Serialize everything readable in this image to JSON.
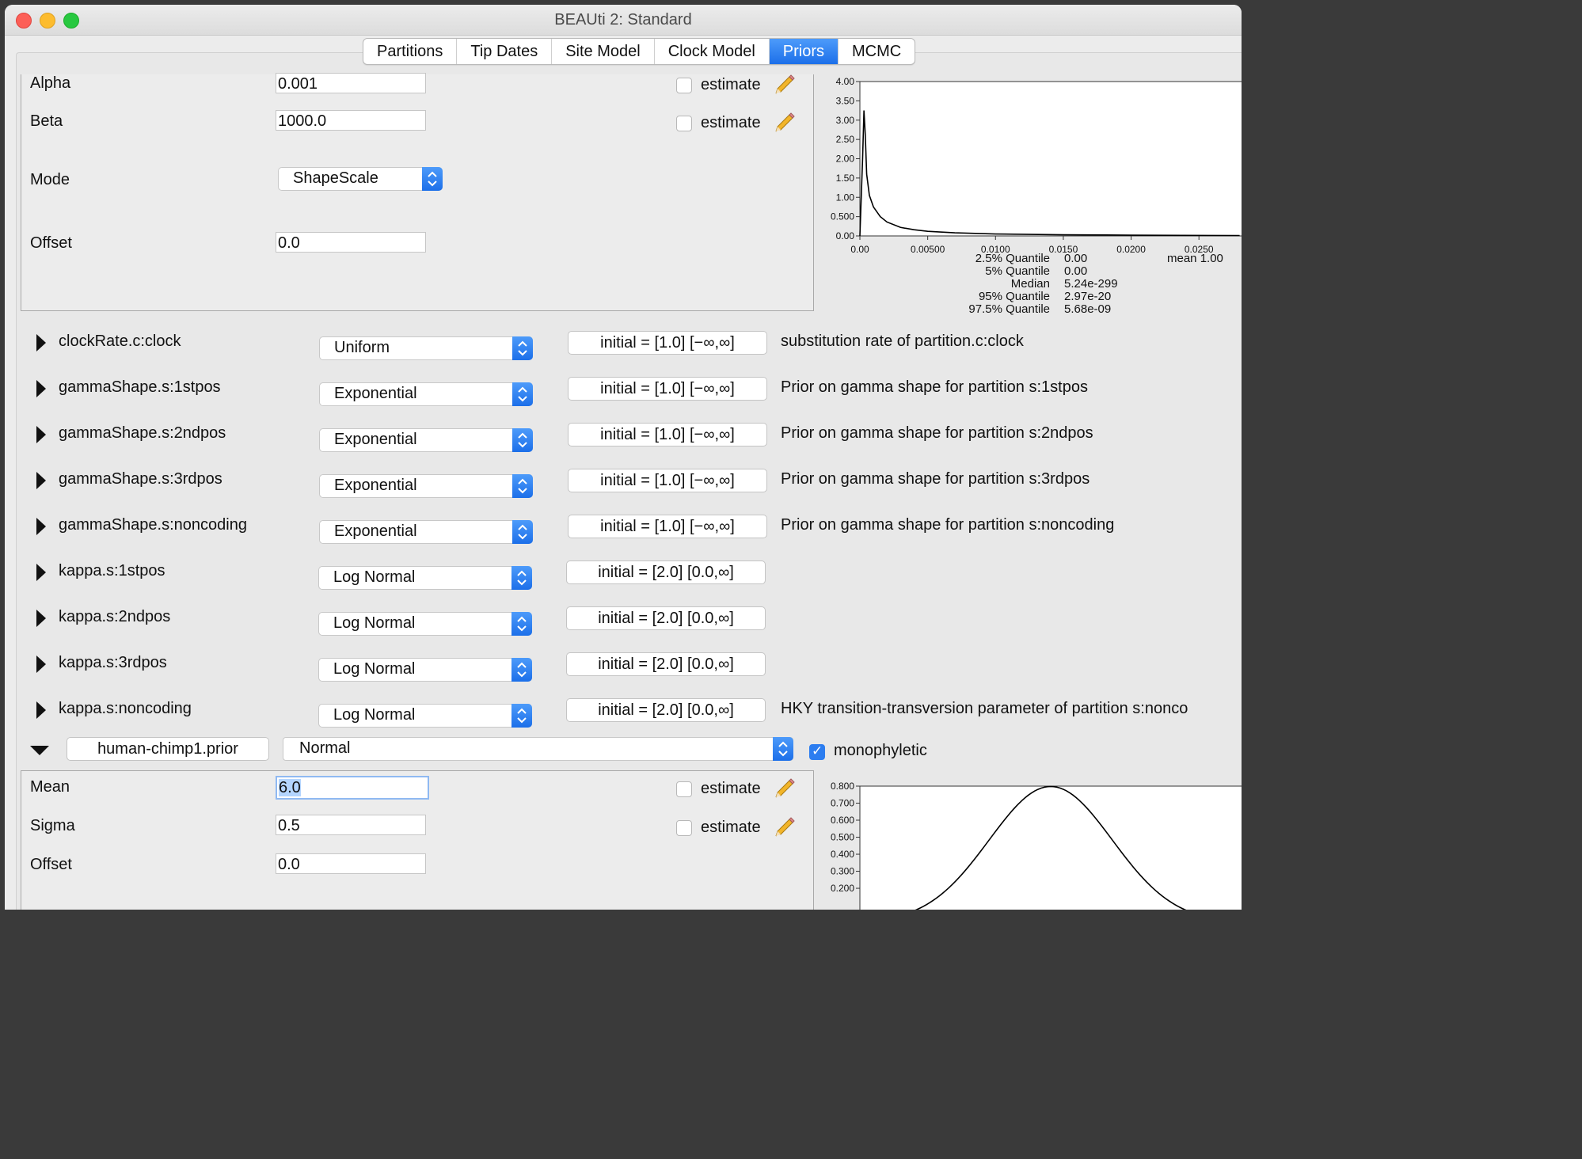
{
  "window": {
    "title": "BEAUti 2: Standard"
  },
  "tabs": [
    {
      "label": "Partitions"
    },
    {
      "label": "Tip Dates"
    },
    {
      "label": "Site Model"
    },
    {
      "label": "Clock Model"
    },
    {
      "label": "Priors",
      "active": true
    },
    {
      "label": "MCMC"
    }
  ],
  "top_panel": {
    "alpha_label": "Alpha",
    "alpha_value": "0.001",
    "beta_label": "Beta",
    "beta_value": "1000.0",
    "mode_label": "Mode",
    "mode_value": "ShapeScale",
    "offset_label": "Offset",
    "offset_value": "0.0",
    "estimate_label": "estimate"
  },
  "top_chart_stats": {
    "q2_5_label": "2.5% Quantile",
    "q2_5_value": "0.00",
    "q5_label": "5% Quantile",
    "q5_value": "0.00",
    "median_label": "Median",
    "median_value": "5.24e-299",
    "q95_label": "95% Quantile",
    "q95_value": "2.97e-20",
    "q97_5_label": "97.5% Quantile",
    "q97_5_value": "5.68e-09",
    "mean_label": "mean 1.00"
  },
  "priors": [
    {
      "name": "clockRate.c:clock",
      "dist": "Uniform",
      "init": "initial = [1.0] [−∞,∞]",
      "desc": "substitution rate of partition.c:clock"
    },
    {
      "name": "gammaShape.s:1stpos",
      "dist": "Exponential",
      "init": "initial = [1.0] [−∞,∞]",
      "desc": "Prior on gamma shape for partition s:1stpos"
    },
    {
      "name": "gammaShape.s:2ndpos",
      "dist": "Exponential",
      "init": "initial = [1.0] [−∞,∞]",
      "desc": "Prior on gamma shape for partition s:2ndpos"
    },
    {
      "name": "gammaShape.s:3rdpos",
      "dist": "Exponential",
      "init": "initial = [1.0] [−∞,∞]",
      "desc": "Prior on gamma shape for partition s:3rdpos"
    },
    {
      "name": "gammaShape.s:noncoding",
      "dist": "Exponential",
      "init": "initial = [1.0] [−∞,∞]",
      "desc": "Prior on gamma shape for partition s:noncoding"
    },
    {
      "name": "kappa.s:1stpos",
      "dist": "Log Normal",
      "init": "initial = [2.0] [0.0,∞]",
      "desc": ""
    },
    {
      "name": "kappa.s:2ndpos",
      "dist": "Log Normal",
      "init": "initial = [2.0] [0.0,∞]",
      "desc": ""
    },
    {
      "name": "kappa.s:3rdpos",
      "dist": "Log Normal",
      "init": "initial = [2.0] [0.0,∞]",
      "desc": ""
    },
    {
      "name": "kappa.s:noncoding",
      "dist": "Log Normal",
      "init": "initial = [2.0] [0.0,∞]",
      "desc": "HKY transition-transversion parameter of partition s:nonco"
    }
  ],
  "mrca": {
    "name": "human-chimp1.prior",
    "dist": "Normal",
    "monophyletic_label": "monophyletic",
    "monophyletic_checked": true
  },
  "bottom_panel": {
    "mean_label": "Mean",
    "mean_value": "6.0",
    "sigma_label": "Sigma",
    "sigma_value": "0.5",
    "offset_label": "Offset",
    "offset_value": "0.0",
    "estimate_label": "estimate"
  },
  "chart_data": [
    {
      "type": "line",
      "title": "",
      "xlabel": "",
      "ylabel": "",
      "x_ticks": [
        "0.00",
        "0.00500",
        "0.0100",
        "0.0150",
        "0.0200",
        "0.0250"
      ],
      "y_ticks": [
        "0.00",
        "0.500",
        "1.00",
        "1.50",
        "2.00",
        "2.50",
        "3.00",
        "3.50",
        "4.00"
      ],
      "xlim": [
        0,
        0.028
      ],
      "ylim": [
        0,
        4.0
      ],
      "series": [
        {
          "x": [
            0.0,
            0.0002,
            0.0003,
            0.0004,
            0.0005,
            0.0007,
            0.001,
            0.0015,
            0.002,
            0.003,
            0.004,
            0.005,
            0.007,
            0.01,
            0.015,
            0.02,
            0.028
          ],
          "y": [
            0.0,
            2.0,
            3.25,
            2.6,
            1.6,
            1.05,
            0.75,
            0.5,
            0.36,
            0.22,
            0.16,
            0.12,
            0.08,
            0.05,
            0.03,
            0.02,
            0.01
          ]
        }
      ]
    },
    {
      "type": "line",
      "title": "",
      "xlabel": "",
      "ylabel": "",
      "y_ticks": [
        "0.200",
        "0.300",
        "0.400",
        "0.500",
        "0.600",
        "0.700",
        "0.800"
      ],
      "xlim": [
        4.45,
        7.55
      ],
      "ylim": [
        0.15,
        0.8
      ],
      "series": [
        {
          "distribution": "normal",
          "mean": 6.0,
          "sigma": 0.5
        }
      ]
    }
  ]
}
